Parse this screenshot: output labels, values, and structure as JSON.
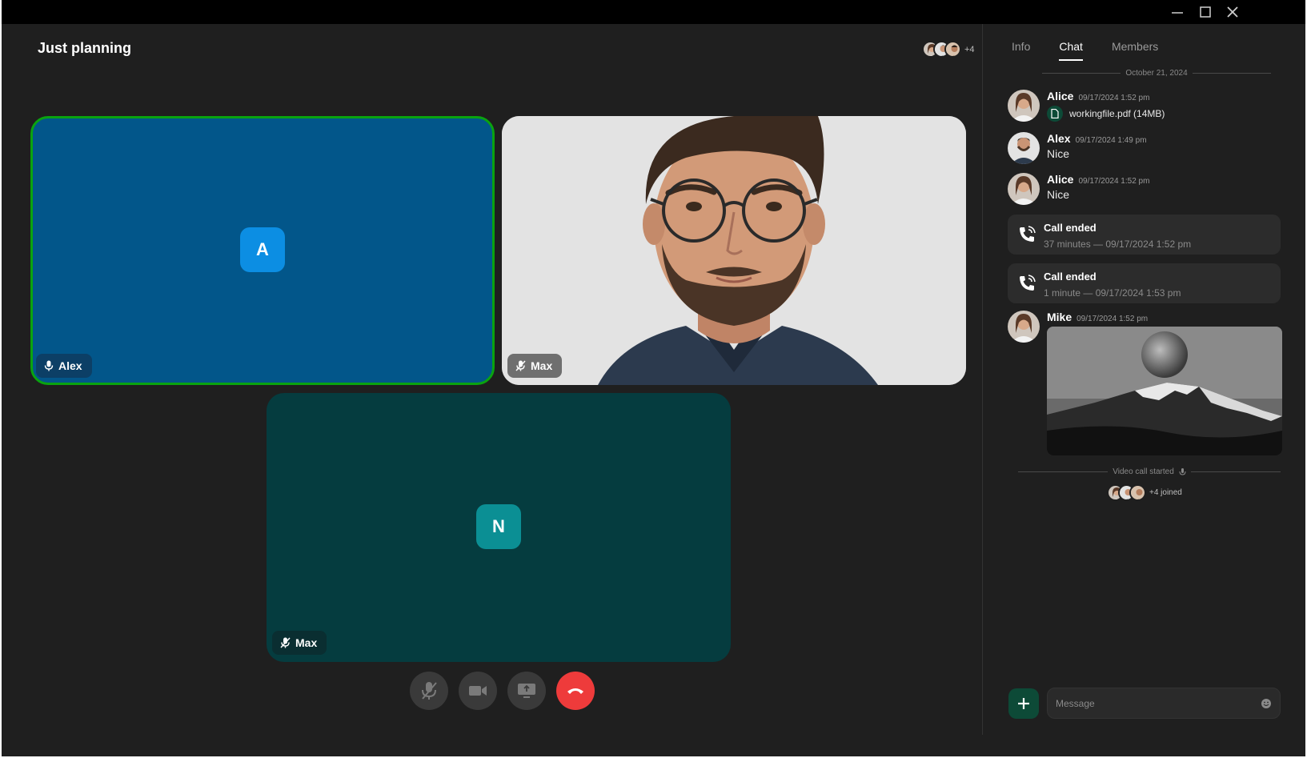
{
  "window": {
    "controls": [
      "minimize-icon",
      "maximize-icon",
      "close-icon"
    ]
  },
  "call": {
    "title": "Just planning",
    "participants_extra": "+4"
  },
  "tiles": [
    {
      "initial": "A",
      "name": "Alex",
      "mic": "mic-icon",
      "bg": "#02568a",
      "avatar_bg": "#0c8ee3",
      "speaking_border": "#0aa310"
    },
    {
      "name": "Max",
      "mic": "mic-off-icon",
      "type": "video"
    },
    {
      "initial": "N",
      "name": "Max",
      "mic": "mic-off-icon",
      "bg": "#053c3f",
      "avatar_bg": "#0b8f94"
    }
  ],
  "controls": [
    {
      "name": "mute-mic-button",
      "icon": "mic-off-icon"
    },
    {
      "name": "camera-button",
      "icon": "video-icon"
    },
    {
      "name": "share-screen-button",
      "icon": "screen-share-icon"
    },
    {
      "name": "end-call-button",
      "icon": "phone-hangup-icon",
      "color": "#ee3b3b"
    }
  ],
  "sidebar": {
    "tabs": [
      "Info",
      "Chat",
      "Members"
    ],
    "active_tab": "Chat",
    "date_separator": "October 21, 2024",
    "messages": [
      {
        "author": "Alice",
        "time": "09/17/2024 1:52 pm",
        "file": "workingfile.pdf (14MB)"
      },
      {
        "author": "Alex",
        "time": "09/17/2024 1:49 pm",
        "text": "Nice"
      },
      {
        "author": "Alice",
        "time": "09/17/2024 1:52 pm",
        "text": "Nice"
      }
    ],
    "call_events": [
      {
        "title": "Call ended",
        "subtitle": "37 minutes — 09/17/2024 1:52 pm"
      },
      {
        "title": "Call ended",
        "subtitle": "1 minute — 09/17/2024 1:53 pm"
      }
    ],
    "image_message": {
      "author": "Mike",
      "time": "09/17/2024 1:52 pm"
    },
    "video_started": "Video call started",
    "joined_text": "+4 joined",
    "input_placeholder": "Message",
    "accent": "#0d4a37"
  }
}
